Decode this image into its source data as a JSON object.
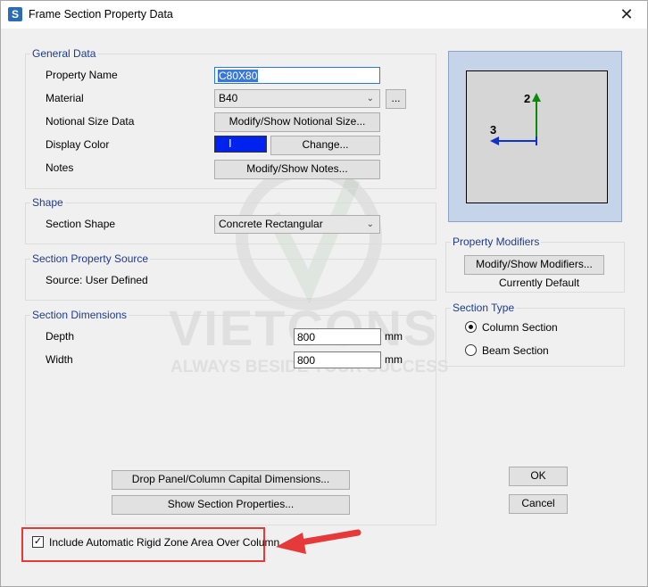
{
  "window": {
    "title": "Frame Section Property Data",
    "close": "✕",
    "app_icon": "S"
  },
  "general": {
    "title": "General Data",
    "property_name_label": "Property Name",
    "property_name_value": "C80X80",
    "material_label": "Material",
    "material_value": "B40",
    "material_more": "...",
    "notional_label": "Notional Size Data",
    "notional_button": "Modify/Show Notional Size...",
    "display_color_label": "Display Color",
    "display_color_value": "#0022ee",
    "change_button": "Change...",
    "notes_label": "Notes",
    "notes_button": "Modify/Show Notes..."
  },
  "shape": {
    "title": "Shape",
    "section_shape_label": "Section Shape",
    "section_shape_value": "Concrete Rectangular"
  },
  "source": {
    "title": "Section Property Source",
    "text": "Source:  User Defined"
  },
  "dimensions": {
    "title": "Section Dimensions",
    "depth_label": "Depth",
    "depth_value": "800",
    "depth_unit": "mm",
    "width_label": "Width",
    "width_value": "800",
    "width_unit": "mm",
    "drop_panel_button": "Drop Panel/Column Capital Dimensions...",
    "show_props_button": "Show Section Properties..."
  },
  "preview": {
    "axis2": "2",
    "axis3": "3"
  },
  "modifiers": {
    "title": "Property Modifiers",
    "button": "Modify/Show Modifiers...",
    "status": "Currently Default"
  },
  "section_type": {
    "title": "Section Type",
    "options": [
      "Column Section",
      "Beam Section"
    ],
    "selected": "Column Section"
  },
  "actions": {
    "ok": "OK",
    "cancel": "Cancel"
  },
  "rigid_zone": {
    "label": "Include Automatic Rigid Zone Area Over Column",
    "checked": true
  },
  "watermark": {
    "brand": "VIETCONS",
    "slogan": "ALWAYS BESIDE YOUR SUCCESS"
  },
  "colors": {
    "highlight": "#e63a3a",
    "group_title": "#1f3a8a",
    "axis2": "#0a8a0a",
    "axis3": "#1030d0"
  }
}
